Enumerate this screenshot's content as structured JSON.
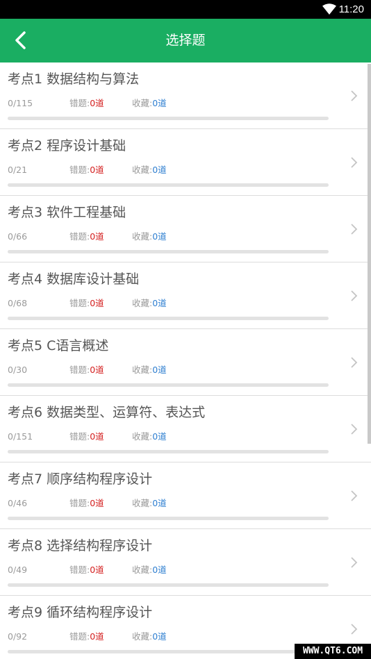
{
  "status_bar": {
    "time": "11:20",
    "wifi_icon": "wifi-icon"
  },
  "app_bar": {
    "title": "选择题",
    "back_icon": "back-arrow-icon",
    "color": "#1aae62"
  },
  "labels": {
    "wrong": "错题:",
    "favorite": "收藏:"
  },
  "topics": [
    {
      "name": "考点1 数据结构与算法",
      "progress": "0/115",
      "wrong": "0道",
      "favorite": "0道",
      "done": 0,
      "total": 115
    },
    {
      "name": "考点2 程序设计基础",
      "progress": "0/21",
      "wrong": "0道",
      "favorite": "0道",
      "done": 0,
      "total": 21
    },
    {
      "name": "考点3 软件工程基础",
      "progress": "0/66",
      "wrong": "0道",
      "favorite": "0道",
      "done": 0,
      "total": 66
    },
    {
      "name": "考点4 数据库设计基础",
      "progress": "0/68",
      "wrong": "0道",
      "favorite": "0道",
      "done": 0,
      "total": 68
    },
    {
      "name": "考点5 C语言概述",
      "progress": "0/30",
      "wrong": "0道",
      "favorite": "0道",
      "done": 0,
      "total": 30
    },
    {
      "name": "考点6 数据类型、运算符、表达式",
      "progress": "0/151",
      "wrong": "0道",
      "favorite": "0道",
      "done": 0,
      "total": 151
    },
    {
      "name": "考点7 顺序结构程序设计",
      "progress": "0/46",
      "wrong": "0道",
      "favorite": "0道",
      "done": 0,
      "total": 46
    },
    {
      "name": "考点8 选择结构程序设计",
      "progress": "0/49",
      "wrong": "0道",
      "favorite": "0道",
      "done": 0,
      "total": 49
    },
    {
      "name": "考点9 循环结构程序设计",
      "progress": "0/92",
      "wrong": "0道",
      "favorite": "0道",
      "done": 0,
      "total": 92
    }
  ],
  "watermark": "WWW.QT6.COM"
}
